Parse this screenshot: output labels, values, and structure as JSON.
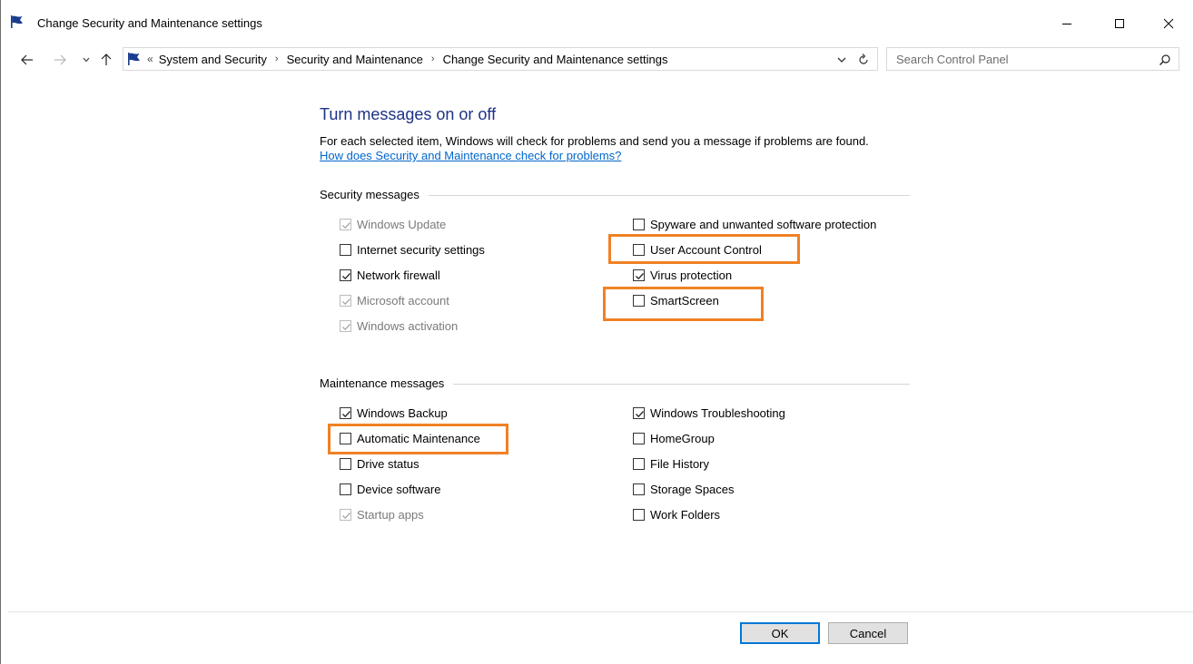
{
  "window": {
    "title": "Change Security and Maintenance settings",
    "accent_color": "#1e3287",
    "highlight_color": "#f08124"
  },
  "addressbar": {
    "crumbs": [
      "System and Security",
      "Security and Maintenance",
      "Change Security and Maintenance settings"
    ],
    "overflow_glyph": "«",
    "separator_glyph": "›"
  },
  "search": {
    "placeholder": "Search Control Panel"
  },
  "content": {
    "heading": "Turn messages on or off",
    "description": "For each selected item, Windows will check for problems and send you a message if problems are found.",
    "help_link": "How does Security and Maintenance check for problems?"
  },
  "security": {
    "header": "Security messages",
    "left": [
      {
        "label": "Windows Update",
        "checked": true,
        "disabled": true
      },
      {
        "label": "Internet security settings",
        "checked": false,
        "disabled": false
      },
      {
        "label": "Network firewall",
        "checked": true,
        "disabled": false
      },
      {
        "label": "Microsoft account",
        "checked": true,
        "disabled": true
      },
      {
        "label": "Windows activation",
        "checked": true,
        "disabled": true
      }
    ],
    "right": [
      {
        "label": "Spyware and unwanted software protection",
        "checked": false,
        "disabled": false
      },
      {
        "label": "User Account Control",
        "checked": false,
        "disabled": false,
        "highlighted": true
      },
      {
        "label": "Virus protection",
        "checked": true,
        "disabled": false
      },
      {
        "label": "SmartScreen",
        "checked": false,
        "disabled": false,
        "highlighted": true
      }
    ]
  },
  "maintenance": {
    "header": "Maintenance messages",
    "left": [
      {
        "label": "Windows Backup",
        "checked": true,
        "disabled": false
      },
      {
        "label": "Automatic Maintenance",
        "checked": false,
        "disabled": false,
        "highlighted": true
      },
      {
        "label": "Drive status",
        "checked": false,
        "disabled": false
      },
      {
        "label": "Device software",
        "checked": false,
        "disabled": false
      },
      {
        "label": "Startup apps",
        "checked": true,
        "disabled": true
      }
    ],
    "right": [
      {
        "label": "Windows Troubleshooting",
        "checked": true,
        "disabled": false
      },
      {
        "label": "HomeGroup",
        "checked": false,
        "disabled": false
      },
      {
        "label": "File History",
        "checked": false,
        "disabled": false
      },
      {
        "label": "Storage Spaces",
        "checked": false,
        "disabled": false
      },
      {
        "label": "Work Folders",
        "checked": false,
        "disabled": false
      }
    ]
  },
  "footer": {
    "ok_label": "OK",
    "cancel_label": "Cancel"
  }
}
